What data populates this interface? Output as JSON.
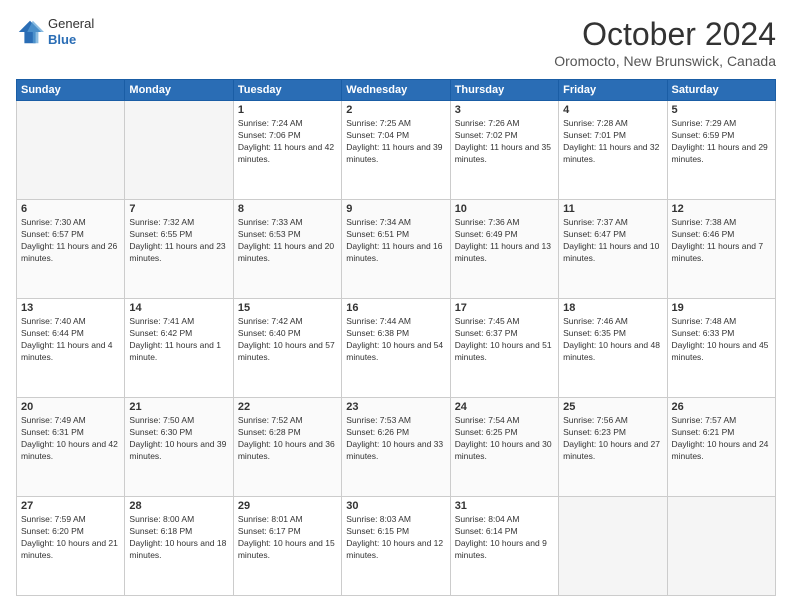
{
  "header": {
    "logo_general": "General",
    "logo_blue": "Blue",
    "month_title": "October 2024",
    "location": "Oromocto, New Brunswick, Canada"
  },
  "weekdays": [
    "Sunday",
    "Monday",
    "Tuesday",
    "Wednesday",
    "Thursday",
    "Friday",
    "Saturday"
  ],
  "weeks": [
    [
      {
        "day": "",
        "empty": true
      },
      {
        "day": "",
        "empty": true
      },
      {
        "day": "1",
        "sunrise": "7:24 AM",
        "sunset": "7:06 PM",
        "daylight": "11 hours and 42 minutes."
      },
      {
        "day": "2",
        "sunrise": "7:25 AM",
        "sunset": "7:04 PM",
        "daylight": "11 hours and 39 minutes."
      },
      {
        "day": "3",
        "sunrise": "7:26 AM",
        "sunset": "7:02 PM",
        "daylight": "11 hours and 35 minutes."
      },
      {
        "day": "4",
        "sunrise": "7:28 AM",
        "sunset": "7:01 PM",
        "daylight": "11 hours and 32 minutes."
      },
      {
        "day": "5",
        "sunrise": "7:29 AM",
        "sunset": "6:59 PM",
        "daylight": "11 hours and 29 minutes."
      }
    ],
    [
      {
        "day": "6",
        "sunrise": "7:30 AM",
        "sunset": "6:57 PM",
        "daylight": "11 hours and 26 minutes."
      },
      {
        "day": "7",
        "sunrise": "7:32 AM",
        "sunset": "6:55 PM",
        "daylight": "11 hours and 23 minutes."
      },
      {
        "day": "8",
        "sunrise": "7:33 AM",
        "sunset": "6:53 PM",
        "daylight": "11 hours and 20 minutes."
      },
      {
        "day": "9",
        "sunrise": "7:34 AM",
        "sunset": "6:51 PM",
        "daylight": "11 hours and 16 minutes."
      },
      {
        "day": "10",
        "sunrise": "7:36 AM",
        "sunset": "6:49 PM",
        "daylight": "11 hours and 13 minutes."
      },
      {
        "day": "11",
        "sunrise": "7:37 AM",
        "sunset": "6:47 PM",
        "daylight": "11 hours and 10 minutes."
      },
      {
        "day": "12",
        "sunrise": "7:38 AM",
        "sunset": "6:46 PM",
        "daylight": "11 hours and 7 minutes."
      }
    ],
    [
      {
        "day": "13",
        "sunrise": "7:40 AM",
        "sunset": "6:44 PM",
        "daylight": "11 hours and 4 minutes."
      },
      {
        "day": "14",
        "sunrise": "7:41 AM",
        "sunset": "6:42 PM",
        "daylight": "11 hours and 1 minute."
      },
      {
        "day": "15",
        "sunrise": "7:42 AM",
        "sunset": "6:40 PM",
        "daylight": "10 hours and 57 minutes."
      },
      {
        "day": "16",
        "sunrise": "7:44 AM",
        "sunset": "6:38 PM",
        "daylight": "10 hours and 54 minutes."
      },
      {
        "day": "17",
        "sunrise": "7:45 AM",
        "sunset": "6:37 PM",
        "daylight": "10 hours and 51 minutes."
      },
      {
        "day": "18",
        "sunrise": "7:46 AM",
        "sunset": "6:35 PM",
        "daylight": "10 hours and 48 minutes."
      },
      {
        "day": "19",
        "sunrise": "7:48 AM",
        "sunset": "6:33 PM",
        "daylight": "10 hours and 45 minutes."
      }
    ],
    [
      {
        "day": "20",
        "sunrise": "7:49 AM",
        "sunset": "6:31 PM",
        "daylight": "10 hours and 42 minutes."
      },
      {
        "day": "21",
        "sunrise": "7:50 AM",
        "sunset": "6:30 PM",
        "daylight": "10 hours and 39 minutes."
      },
      {
        "day": "22",
        "sunrise": "7:52 AM",
        "sunset": "6:28 PM",
        "daylight": "10 hours and 36 minutes."
      },
      {
        "day": "23",
        "sunrise": "7:53 AM",
        "sunset": "6:26 PM",
        "daylight": "10 hours and 33 minutes."
      },
      {
        "day": "24",
        "sunrise": "7:54 AM",
        "sunset": "6:25 PM",
        "daylight": "10 hours and 30 minutes."
      },
      {
        "day": "25",
        "sunrise": "7:56 AM",
        "sunset": "6:23 PM",
        "daylight": "10 hours and 27 minutes."
      },
      {
        "day": "26",
        "sunrise": "7:57 AM",
        "sunset": "6:21 PM",
        "daylight": "10 hours and 24 minutes."
      }
    ],
    [
      {
        "day": "27",
        "sunrise": "7:59 AM",
        "sunset": "6:20 PM",
        "daylight": "10 hours and 21 minutes."
      },
      {
        "day": "28",
        "sunrise": "8:00 AM",
        "sunset": "6:18 PM",
        "daylight": "10 hours and 18 minutes."
      },
      {
        "day": "29",
        "sunrise": "8:01 AM",
        "sunset": "6:17 PM",
        "daylight": "10 hours and 15 minutes."
      },
      {
        "day": "30",
        "sunrise": "8:03 AM",
        "sunset": "6:15 PM",
        "daylight": "10 hours and 12 minutes."
      },
      {
        "day": "31",
        "sunrise": "8:04 AM",
        "sunset": "6:14 PM",
        "daylight": "10 hours and 9 minutes."
      },
      {
        "day": "",
        "empty": true
      },
      {
        "day": "",
        "empty": true
      }
    ]
  ]
}
